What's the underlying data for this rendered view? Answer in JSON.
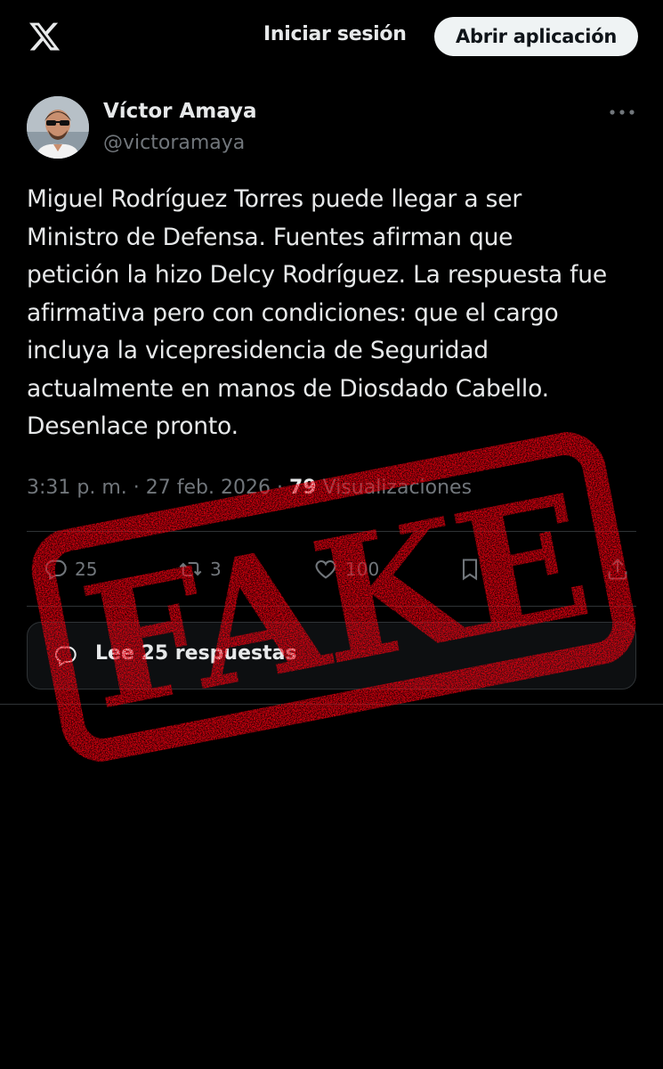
{
  "header": {
    "logo_icon": "x-logo-icon",
    "login_label": "Iniciar sesión",
    "open_app_label": "Abrir aplicación"
  },
  "author": {
    "name": "Víctor Amaya",
    "handle": "@victoramaya"
  },
  "tweet": {
    "text": "Miguel Rodríguez Torres puede llegar a ser\nMinistro de Defensa. Fuentes afirman que\npetición la hizo Delcy Rodríguez. La respuesta fue\nafirmativa pero con condiciones: que el cargo\nincluya la vicepresidencia de Seguridad\nactualmente en manos de Diosdado Cabello.\nDesenlace pronto.",
    "time": "3:31 p. m.",
    "date": "27 feb. 2026",
    "views_count": "79",
    "views_label": "Visualizaciones"
  },
  "actions": {
    "replies": "25",
    "reposts": "3",
    "likes": "100"
  },
  "replies_box": {
    "label": "Lee 25 respuestas"
  },
  "stamp": {
    "text": "FAKE",
    "color": "#e3000f"
  },
  "colors": {
    "background": "#000000",
    "text": "#e7e9ea",
    "muted": "#71767b",
    "border": "#2f3336"
  }
}
